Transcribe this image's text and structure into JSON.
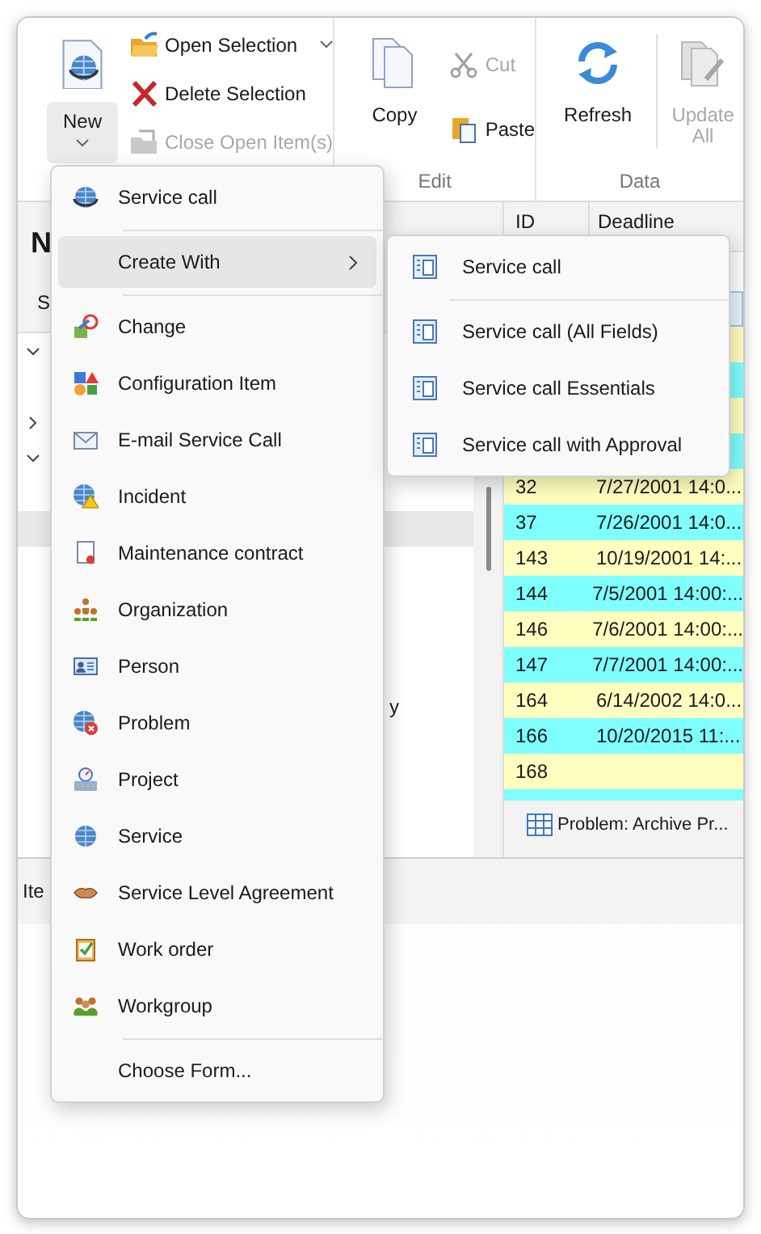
{
  "ribbon": {
    "groups": [
      {
        "buttons": [
          {
            "kind": "split",
            "label": "New",
            "pressed": true
          },
          {
            "kind": "small",
            "label": "Open Selection",
            "dropdown": true,
            "disabled": false
          },
          {
            "kind": "small",
            "label": "Delete Selection",
            "dropdown": false,
            "disabled": false
          },
          {
            "kind": "small",
            "label": "Close Open Item(s)",
            "dropdown": false,
            "disabled": true
          }
        ]
      },
      {
        "label": "Edit",
        "buttons": [
          {
            "kind": "large",
            "label": "Copy",
            "disabled": false
          },
          {
            "kind": "small",
            "label": "Cut",
            "dropdown": false,
            "disabled": true
          },
          {
            "kind": "small",
            "label": "Paste",
            "dropdown": false,
            "disabled": false
          }
        ]
      },
      {
        "label": "Data",
        "buttons": [
          {
            "kind": "large",
            "label": "Refresh",
            "disabled": false
          },
          {
            "kind": "large",
            "label": "Update All",
            "disabled": true
          }
        ]
      }
    ]
  },
  "navigator": {
    "heading": "N",
    "tab": "S",
    "tree_rows": [
      {
        "kind": "expander",
        "expanded": true,
        "selected": false
      },
      {
        "kind": "leaf",
        "selected": false
      },
      {
        "kind": "expander",
        "expanded": false,
        "selected": false
      },
      {
        "kind": "expander",
        "expanded": true,
        "selected": false
      },
      {
        "kind": "leaf",
        "selected": false
      },
      {
        "kind": "leaf",
        "selected": true
      },
      {
        "kind": "leaf",
        "selected": false
      },
      {
        "kind": "leaf",
        "selected": false
      },
      {
        "kind": "leaf",
        "selected": false
      },
      {
        "kind": "leaf",
        "selected": false
      },
      {
        "kind": "leaf",
        "label": "y",
        "selected": false
      }
    ]
  },
  "grid": {
    "columns": [
      "ID",
      "Deadline"
    ],
    "rows": [
      {
        "color": "#eaf3ff",
        "selected": true
      },
      {
        "color": "#ffffc0",
        "selected": false
      },
      {
        "color": "#80ffff",
        "selected": false
      },
      {
        "color": "#ffffc0",
        "selected": false
      },
      {
        "color": "#80ffff",
        "selected": false
      },
      {
        "id": "32",
        "deadline": "7/27/2001 14:0...",
        "color": "#ffffc0",
        "selected": false
      },
      {
        "id": "37",
        "deadline": "7/26/2001 14:0...",
        "color": "#80ffff",
        "selected": false
      },
      {
        "id": "143",
        "deadline": "10/19/2001 14:...",
        "color": "#ffffc0",
        "selected": false
      },
      {
        "id": "144",
        "deadline": "7/5/2001 14:00:...",
        "color": "#80ffff",
        "selected": false
      },
      {
        "id": "146",
        "deadline": "7/6/2001 14:00:...",
        "color": "#ffffc0",
        "selected": false
      },
      {
        "id": "147",
        "deadline": "7/7/2001 14:00:...",
        "color": "#80ffff",
        "selected": false
      },
      {
        "id": "164",
        "deadline": "6/14/2002 14:0...",
        "color": "#ffffc0",
        "selected": false
      },
      {
        "id": "166",
        "deadline": "10/20/2015 11:...",
        "color": "#80ffff",
        "selected": false
      },
      {
        "id": "168",
        "color": "#ffffc0",
        "selected": false
      },
      {
        "color": "#80ffff",
        "selected": false
      }
    ],
    "tab": "Problem: Archive Pr..."
  },
  "status_bar": {
    "text": "Ite"
  },
  "new_menu": {
    "items": [
      {
        "kind": "item",
        "label": "Service call",
        "selected": false
      },
      {
        "kind": "separator"
      },
      {
        "kind": "submenu",
        "label": "Create With",
        "selected": true
      },
      {
        "kind": "separator"
      },
      {
        "kind": "item",
        "label": "Change",
        "selected": false
      },
      {
        "kind": "item",
        "label": "Configuration Item",
        "selected": false
      },
      {
        "kind": "item",
        "label": "E-mail Service Call",
        "selected": false
      },
      {
        "kind": "item",
        "label": "Incident",
        "selected": false
      },
      {
        "kind": "item",
        "label": "Maintenance contract",
        "selected": false
      },
      {
        "kind": "item",
        "label": "Organization",
        "selected": false
      },
      {
        "kind": "item",
        "label": "Person",
        "selected": false
      },
      {
        "kind": "item",
        "label": "Problem",
        "selected": false
      },
      {
        "kind": "item",
        "label": "Project",
        "selected": false
      },
      {
        "kind": "item",
        "label": "Service",
        "selected": false
      },
      {
        "kind": "item",
        "label": "Service Level Agreement",
        "selected": false
      },
      {
        "kind": "item",
        "label": "Work order",
        "selected": false
      },
      {
        "kind": "item",
        "label": "Workgroup",
        "selected": false
      },
      {
        "kind": "separator"
      },
      {
        "kind": "plain",
        "label": "Choose Form...",
        "selected": false
      }
    ]
  },
  "create_with_menu": {
    "items": [
      {
        "kind": "item",
        "label": "Service call",
        "selected": false
      },
      {
        "kind": "separator"
      },
      {
        "kind": "item",
        "label": "Service call (All Fields)",
        "selected": false
      },
      {
        "kind": "item",
        "label": "Service call Essentials",
        "selected": false
      },
      {
        "kind": "item",
        "label": "Service call with Approval",
        "selected": false
      }
    ]
  }
}
